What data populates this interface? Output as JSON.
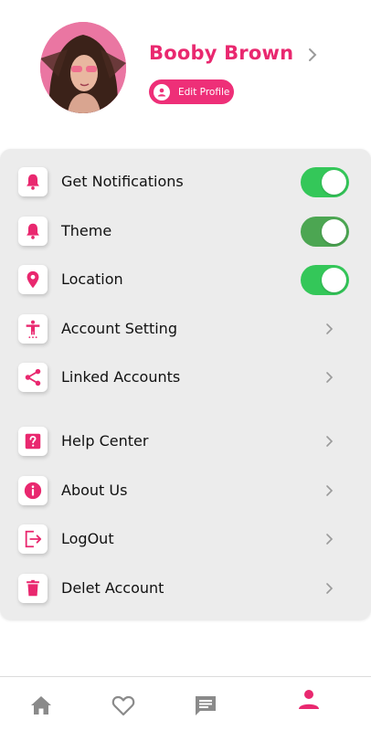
{
  "profile": {
    "name": "Booby Brown",
    "edit_label": "Edit Profile"
  },
  "settings": [
    {
      "label": "Get Notifications",
      "icon": "bell-icon",
      "control": "toggle",
      "on": true
    },
    {
      "label": "Theme",
      "icon": "bell-icon",
      "control": "toggle",
      "on": true
    },
    {
      "label": "Location",
      "icon": "location-pin-icon",
      "control": "toggle",
      "on": true
    },
    {
      "label": "Account Setting",
      "icon": "accessibility-person-icon",
      "control": "chevron"
    },
    {
      "label": "Linked Accounts",
      "icon": "share-icon",
      "control": "chevron"
    },
    {
      "label": "Help Center",
      "icon": "help-question-icon",
      "control": "chevron"
    },
    {
      "label": "About Us",
      "icon": "info-icon",
      "control": "chevron"
    },
    {
      "label": "LogOut",
      "icon": "logout-icon",
      "control": "chevron"
    },
    {
      "label": "Delet Account",
      "icon": "trash-icon",
      "control": "chevron"
    }
  ],
  "nav": [
    {
      "name": "home",
      "icon": "home-icon",
      "active": false
    },
    {
      "name": "favorites",
      "icon": "heart-icon",
      "active": false
    },
    {
      "name": "messages",
      "icon": "chat-icon",
      "active": false
    },
    {
      "name": "profile",
      "icon": "person-icon",
      "active": true
    }
  ],
  "colors": {
    "accent": "#e9286f",
    "toggle_on": "#34c759",
    "panel_bg": "#ececec",
    "nav_inactive": "#8a8a8a"
  }
}
